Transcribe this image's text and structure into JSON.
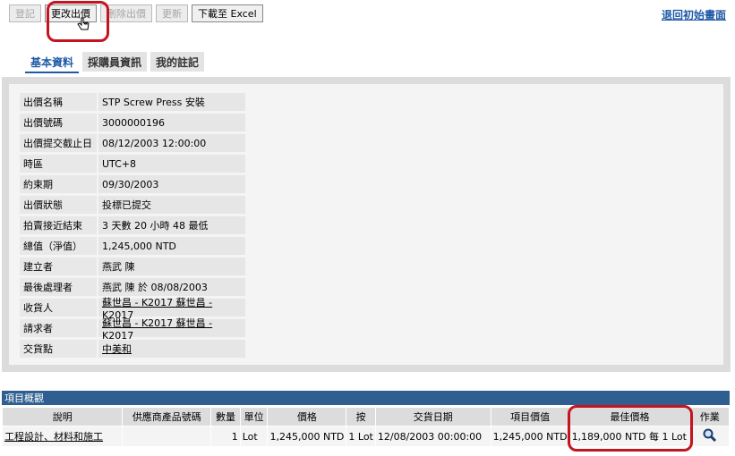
{
  "toolbar": {
    "buttons": [
      {
        "label": "登記",
        "enabled": false
      },
      {
        "label": "更改出價",
        "enabled": true
      },
      {
        "label": "刪除出價",
        "enabled": false
      },
      {
        "label": "更新",
        "enabled": false
      },
      {
        "label": "下載至 Excel",
        "enabled": true
      }
    ],
    "back_link": "退回初始畫面"
  },
  "tabs": [
    {
      "label": "基本資料",
      "selected": true
    },
    {
      "label": "採購員資訊",
      "selected": false
    },
    {
      "label": "我的註記",
      "selected": false
    }
  ],
  "details": [
    {
      "label": "出價名稱",
      "value": "STP Screw Press 安裝",
      "link": false
    },
    {
      "label": "出價號碼",
      "value": "3000000196",
      "link": false
    },
    {
      "label": "出價提交截止日",
      "value": "08/12/2003  12:00:00",
      "link": false
    },
    {
      "label": "時區",
      "value": "UTC+8",
      "link": false
    },
    {
      "label": "約束期",
      "value": "09/30/2003",
      "link": false
    },
    {
      "label": "出價狀態",
      "value": "投標已提交",
      "link": false
    },
    {
      "label": "拍賣接近結束",
      "value": "3 天數 20 小時 48 最低",
      "link": false
    },
    {
      "label": "總值（淨值）",
      "value": "1,245,000  NTD",
      "link": false
    },
    {
      "label": "建立者",
      "value": "燕武  陳",
      "link": false
    },
    {
      "label": "最後處理者",
      "value": "燕武  陳 於  08/08/2003",
      "link": false
    },
    {
      "label": "收貨人",
      "value": "蘇世昌 - K2017 蘇世昌 - K2017",
      "link": true
    },
    {
      "label": "請求者",
      "value": "蘇世昌 - K2017 蘇世昌 - K2017",
      "link": true
    },
    {
      "label": "交貨點",
      "value": "中美和",
      "link": true
    }
  ],
  "items": {
    "title": "項目概觀",
    "headers": [
      "說明",
      "供應商產品號碼",
      "數量",
      "單位",
      "價格",
      "按",
      "交貨日期",
      "項目價值",
      "最佳價格",
      "作業"
    ],
    "rows": [
      {
        "desc": "工程設計、材料和施工",
        "supplier_no": "",
        "qty": "1",
        "unit": "Lot",
        "price": "1,245,000 NTD",
        "per": "1 Lot",
        "date": "12/08/2003  00:00:00",
        "value": "1,245,000  NTD",
        "best": "1,189,000  NTD 每 1 Lot"
      }
    ]
  },
  "colors": {
    "accent": "#1f5aa6",
    "header_bar": "#2e5f90",
    "highlight": "#c3141f"
  }
}
